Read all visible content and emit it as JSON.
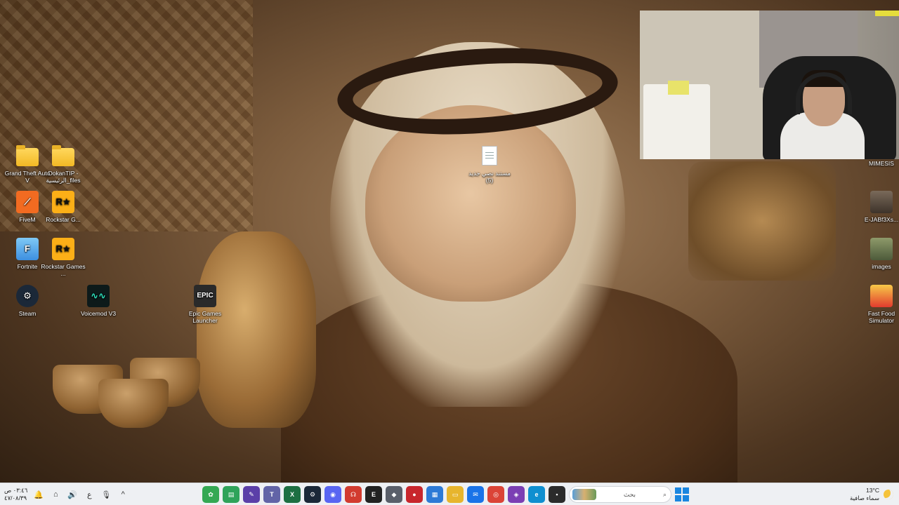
{
  "desktop": {
    "left_icons": [
      {
        "id": "gta",
        "label": "Grand Theft Auto V",
        "icon": "folder-icon"
      },
      {
        "id": "dokan",
        "label": "DokanTIP - الرئيسية_files",
        "icon": "folder-icon"
      },
      {
        "id": "fivem",
        "label": "FiveM",
        "icon": "fivem-icon"
      },
      {
        "id": "rockstar-g",
        "label": "Rockstar G...",
        "icon": "rockstar-icon"
      },
      {
        "id": "fortnite",
        "label": "Fortnite",
        "icon": "fortnite-icon"
      },
      {
        "id": "rockstar-games",
        "label": "Rockstar Games ...",
        "icon": "rockstar-icon"
      },
      {
        "id": "steam",
        "label": "Steam",
        "icon": "steam-icon"
      },
      {
        "id": "voicemod",
        "label": "Voicemod V3",
        "icon": "voicemod-icon"
      },
      {
        "id": "epic",
        "label": "Epic Games Launcher",
        "icon": "epic-games-icon",
        "glyph_text": "EPIC"
      }
    ],
    "center_icon": {
      "label": "مستند نصي جديد (5)",
      "icon": "text-document-icon"
    },
    "right_icons": [
      {
        "id": "mimesis",
        "label": "MIMESIS",
        "icon": "mimesis-icon"
      },
      {
        "id": "ejab",
        "label": "E-JABf3Xs...",
        "icon": "image-thumbnail-icon"
      },
      {
        "id": "images",
        "label": "images",
        "icon": "image-thumbnail-icon"
      },
      {
        "id": "fastfood",
        "label": "Fast Food Simulator",
        "icon": "fast-food-simulator-icon"
      }
    ],
    "glyphs": {
      "fivem": "⟋",
      "rockstar": "R★",
      "fortnite": "F",
      "steam": "⚙",
      "voicemod": "∿∿"
    }
  },
  "webcam": {
    "label": "webcam-overlay"
  },
  "taskbar": {
    "clock": {
      "time": "٠٣:٤٦ ص",
      "date": "٤٧/٠٨/٣٩"
    },
    "tray": {
      "bell": "🔔",
      "network": "⌂",
      "volume": "🔊",
      "lang": "ع",
      "mic": "🎙",
      "chevron": "^"
    },
    "apps": [
      {
        "name": "widgets-app-icon",
        "glyph": "✿",
        "color": "#34a853"
      },
      {
        "name": "notes-app-icon",
        "glyph": "▤",
        "color": "#2fa35a"
      },
      {
        "name": "pen-app-icon",
        "glyph": "✎",
        "color": "#5b3fa8"
      },
      {
        "name": "teams-app-icon",
        "glyph": "T",
        "color": "#6264a7"
      },
      {
        "name": "excel-app-icon",
        "glyph": "X",
        "color": "#1d6f42"
      },
      {
        "name": "steam-app-icon",
        "glyph": "⚙",
        "color": "#1b2838"
      },
      {
        "name": "discord-app-icon",
        "glyph": "◉",
        "color": "#5865f2"
      },
      {
        "name": "headset-app-icon",
        "glyph": "☊",
        "color": "#d23b2f"
      },
      {
        "name": "epic-app-icon",
        "glyph": "E",
        "color": "#222222"
      },
      {
        "name": "cube-app-icon",
        "glyph": "◆",
        "color": "#5a5f6a"
      },
      {
        "name": "game-app-icon",
        "glyph": "●",
        "color": "#c8262c"
      },
      {
        "name": "store-app-icon",
        "glyph": "▦",
        "color": "#2d7ad6"
      },
      {
        "name": "explorer-app-icon",
        "glyph": "▭",
        "color": "#e7b52d"
      },
      {
        "name": "mail-app-icon",
        "glyph": "✉",
        "color": "#1a73e8"
      },
      {
        "name": "chrome-app-icon",
        "glyph": "◎",
        "color": "#db4437"
      },
      {
        "name": "vpn-app-icon",
        "glyph": "◈",
        "color": "#7b3fb4"
      },
      {
        "name": "edge-app-icon",
        "glyph": "e",
        "color": "#0f8fd0"
      },
      {
        "name": "terminal-app-icon",
        "glyph": "▪",
        "color": "#2b2b2b"
      }
    ],
    "search": {
      "placeholder": "بحث",
      "icon": "search-icon"
    },
    "weather": {
      "temp": "13°C",
      "desc": "سماء صافية"
    }
  }
}
